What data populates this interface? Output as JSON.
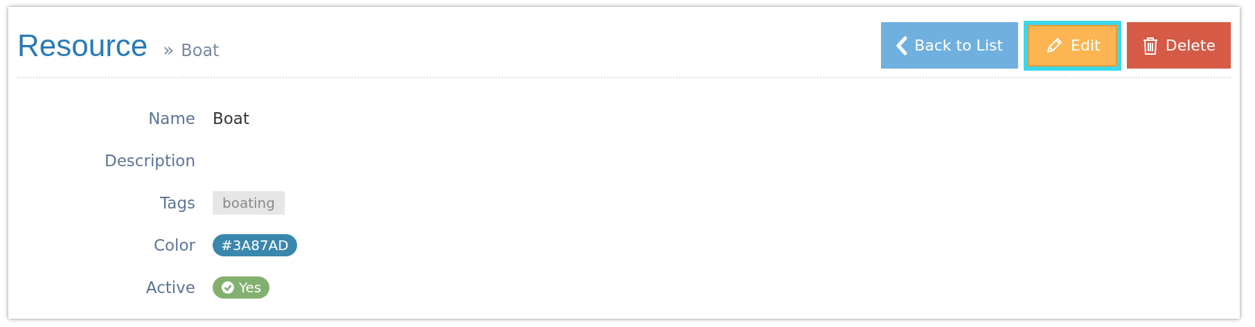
{
  "header": {
    "title": "Resource",
    "breadcrumb_separator": "»",
    "breadcrumb": "Boat"
  },
  "buttons": [
    {
      "label": "Back to List",
      "kind": "back",
      "focused": false
    },
    {
      "label": "Edit",
      "kind": "edit",
      "focused": true
    },
    {
      "label": "Delete",
      "kind": "delete",
      "focused": false
    }
  ],
  "fields": [
    {
      "label": "Name",
      "kind": "text",
      "value": "Boat"
    },
    {
      "label": "Description",
      "kind": "text"
    },
    {
      "label": "Tags",
      "kind": "tags",
      "tags": [
        "boating"
      ]
    },
    {
      "label": "Color",
      "kind": "color",
      "value": "#3A87AD",
      "color": "#3a87ad"
    },
    {
      "label": "Active",
      "kind": "status",
      "value": "Yes",
      "on": true
    }
  ]
}
